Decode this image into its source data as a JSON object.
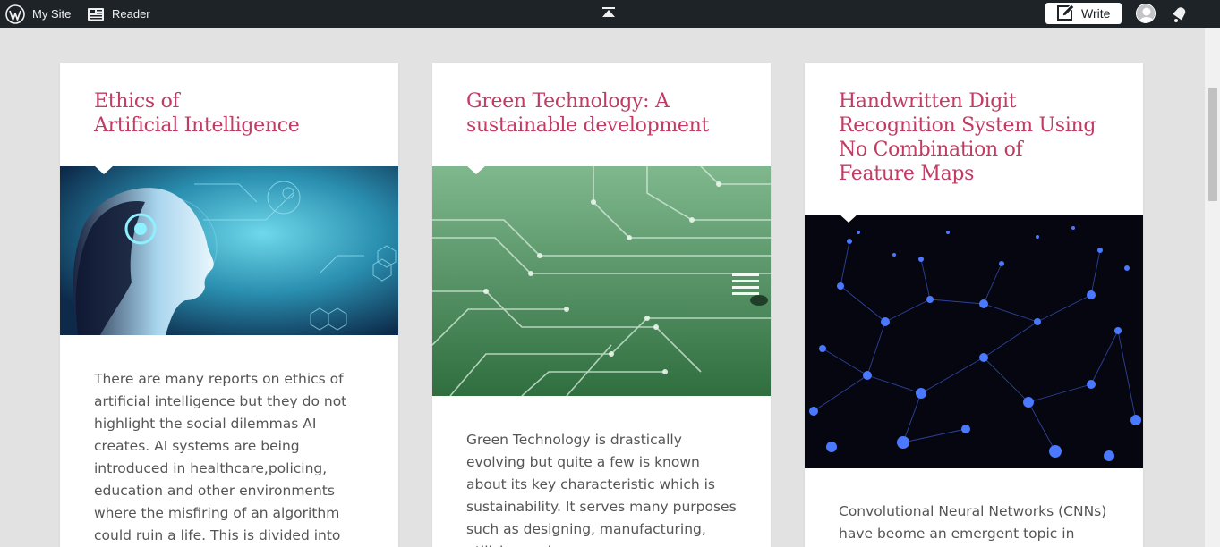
{
  "adminbar": {
    "mysite_label": "My Site",
    "reader_label": "Reader",
    "write_label": "Write",
    "bg_color": "#1d2327"
  },
  "cards": [
    {
      "title_line1": "Ethics of",
      "title_line2": "Artificial Intelligence",
      "excerpt": "There are many reports on ethics of artificial intelligence but they do not highlight the social dilemmas AI creates. AI systems are being introduced in healthcare,policing, education and other environments where the misfiring of an algorithm could ruin a life. This is divided into",
      "image": "ai-robot-head-image"
    },
    {
      "title_line1": "Green Technology: A",
      "title_line2": "sustainable development",
      "excerpt": "Green Technology is drastically evolving but quite a few is known about its key characteristic which is sustainability. It serves many purposes such as designing, manufacturing, utilizing and",
      "image": "circuit-board-image"
    },
    {
      "title_line1": "Handwritten Digit",
      "title_line2": "Recognition System Using",
      "title_line3": "No Combination of",
      "title_line4": "Feature Maps",
      "excerpt": "Convolutional Neural Networks (CNNs) have beome an emergent topic in",
      "image": "neural-network-image"
    }
  ],
  "colors": {
    "title": "#c13b63",
    "page_bg": "#e2e2e2",
    "excerpt": "#555555"
  }
}
